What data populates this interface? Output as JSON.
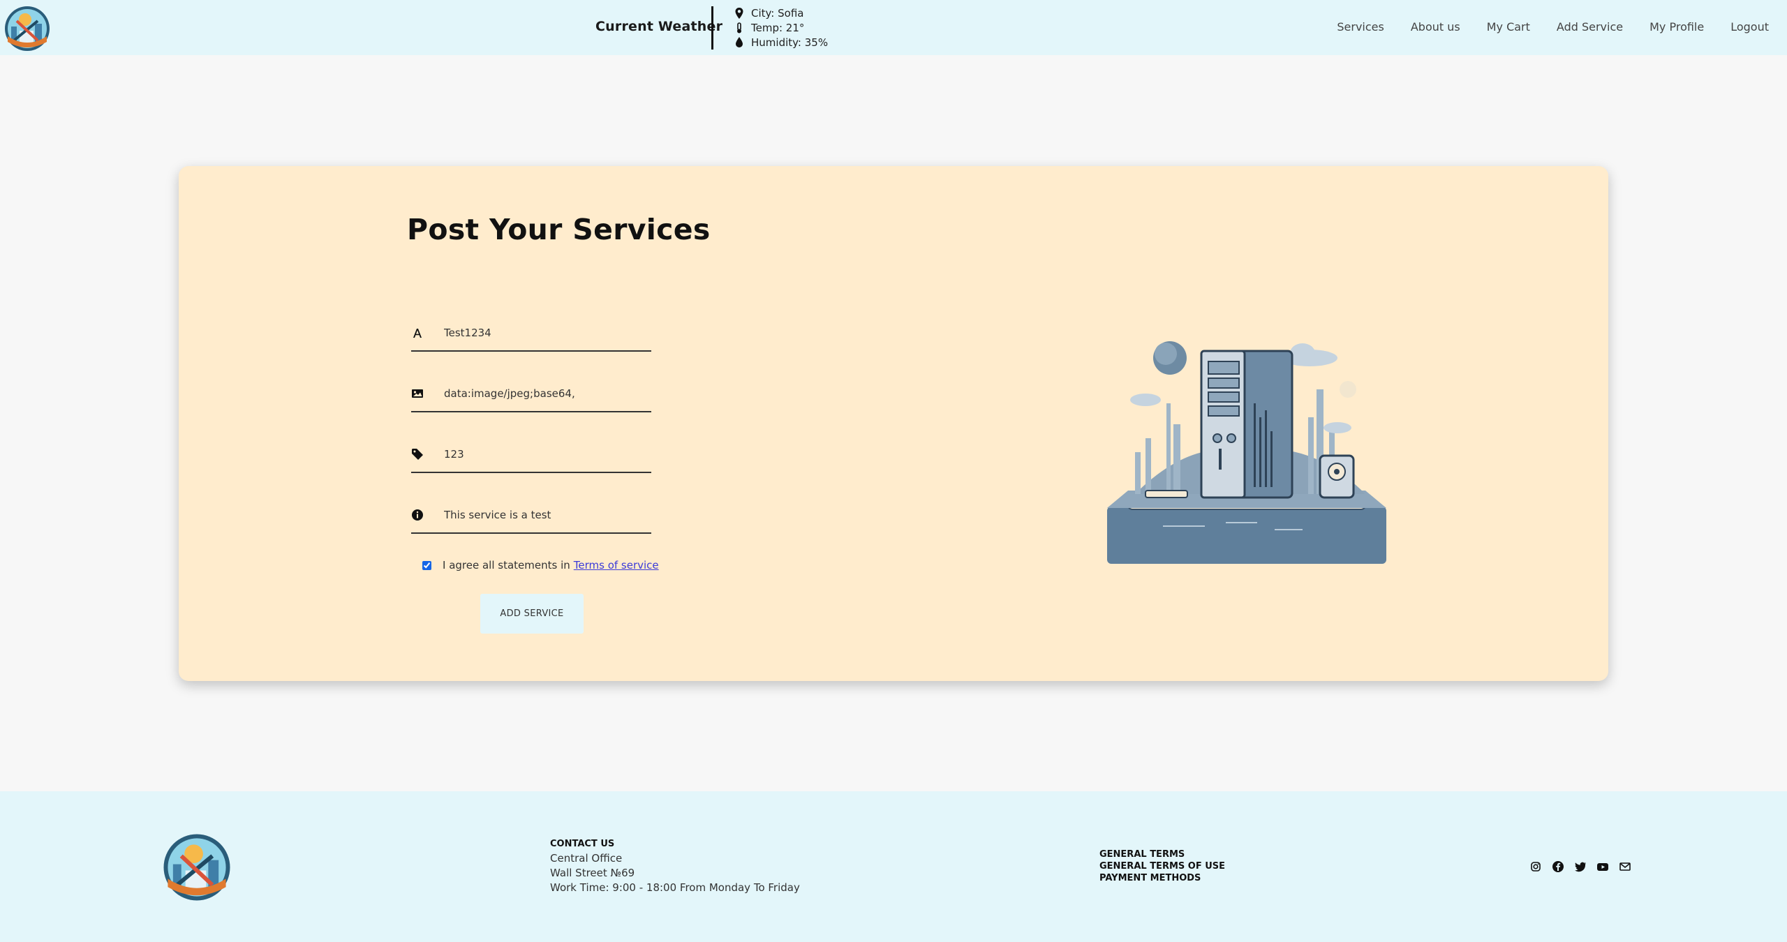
{
  "header": {
    "weather_title": "Current Weather",
    "weather": {
      "city": "City: Sofia",
      "temp": "Temp: 21°",
      "humidity": "Humidity: 35%"
    },
    "nav": [
      "Services",
      "About us",
      "My Cart",
      "Add Service",
      "My Profile",
      "Logout"
    ]
  },
  "form": {
    "title": "Post Your Services",
    "fields": {
      "name": {
        "value": "Test1234",
        "icon": "font-icon"
      },
      "image": {
        "value": "data:image/jpeg;base64,",
        "icon": "image-icon"
      },
      "price": {
        "value": "123",
        "icon": "tag-icon"
      },
      "description": {
        "value": "This service is a test",
        "icon": "info-icon"
      }
    },
    "agree_text": "I agree all statements in",
    "terms_link": "Terms of service",
    "agree_checked": true,
    "submit_label": "ADD SERVICE"
  },
  "footer": {
    "contact_heading": "CONTACT US",
    "contact_lines": [
      "Central Office",
      "Wall Street №69",
      "Work Time: 9:00 - 18:00 From Monday To Friday"
    ],
    "terms": [
      "GENERAL TERMS",
      "GENERAL TERMS OF USE",
      "PAYMENT METHODS"
    ],
    "social": [
      "instagram-icon",
      "facebook-icon",
      "twitter-icon",
      "youtube-icon",
      "mail-icon"
    ]
  },
  "colors": {
    "header_bg": "#e3f6fa",
    "card_bg": "#ffeccd",
    "page_bg": "#f7f7f7",
    "link": "#3b3bd8"
  }
}
